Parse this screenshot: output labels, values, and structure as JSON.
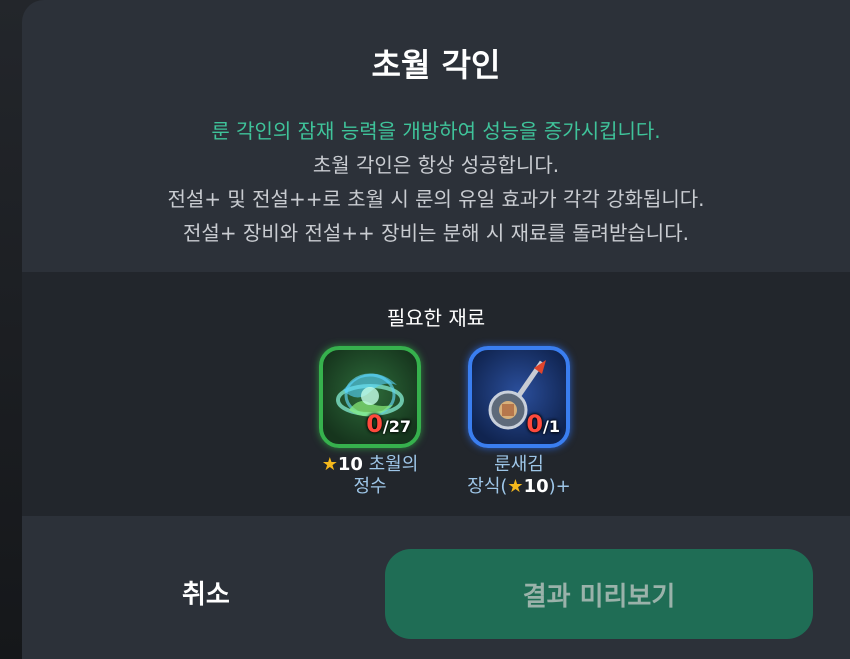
{
  "dialog": {
    "title": "초월 각인",
    "description": [
      "룬 각인의 잠재 능력을 개방하여 성능을 증가시킵니다.",
      "초월 각인은 항상 성공합니다.",
      "전설+ 및 전설++로 초월 시 룬의 유일 효과가 각각 강화됩니다.",
      "전설+ 장비와 전설++ 장비는 분해 시 재료를 돌려받습니다."
    ]
  },
  "materials": {
    "title": "필요한 재료",
    "items": [
      {
        "icon": "essence-swirl-icon",
        "have": "0",
        "need": "/27",
        "star": "★",
        "star_num": "10",
        "name_line1": "초월의",
        "name_line2": "정수"
      },
      {
        "icon": "rune-carving-icon",
        "have": "0",
        "need": "/1",
        "name_line1": "룬새김",
        "name_line2_prefix": "장식(",
        "star": "★",
        "star_num": "10",
        "name_line2_suffix": ")+"
      }
    ]
  },
  "buttons": {
    "cancel": "취소",
    "preview": "결과 미리보기"
  },
  "colors": {
    "accent_green": "#3fc39a",
    "count_red": "#ff4a3d",
    "star_gold": "#f5b81c",
    "button_green": "#1f6d55"
  }
}
